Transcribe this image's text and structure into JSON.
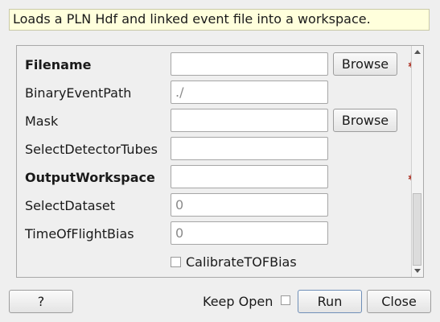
{
  "description": "Loads a PLN Hdf and linked event file into a workspace.",
  "fields": [
    {
      "label": "Filename",
      "value": "",
      "placeholder": "",
      "bold": true,
      "browse": "Browse",
      "required": true
    },
    {
      "label": "BinaryEventPath",
      "value": "",
      "placeholder": "./"
    },
    {
      "label": "Mask",
      "value": "",
      "placeholder": "",
      "browse": "Browse"
    },
    {
      "label": "SelectDetectorTubes",
      "value": "",
      "placeholder": ""
    },
    {
      "label": "OutputWorkspace",
      "value": "",
      "placeholder": "",
      "bold": true,
      "required": true
    },
    {
      "label": "SelectDataset",
      "value": "",
      "placeholder": "0"
    },
    {
      "label": "TimeOfFlightBias",
      "value": "",
      "placeholder": "0"
    }
  ],
  "checkbox": {
    "label": "CalibrateTOFBias",
    "checked": false
  },
  "footer": {
    "help_label": "?",
    "keep_open_label": "Keep Open",
    "keep_open_checked": false,
    "run_label": "Run",
    "close_label": "Close"
  },
  "colors": {
    "description_bg": "#ffffdc",
    "required_marker": "#b03a2e"
  }
}
